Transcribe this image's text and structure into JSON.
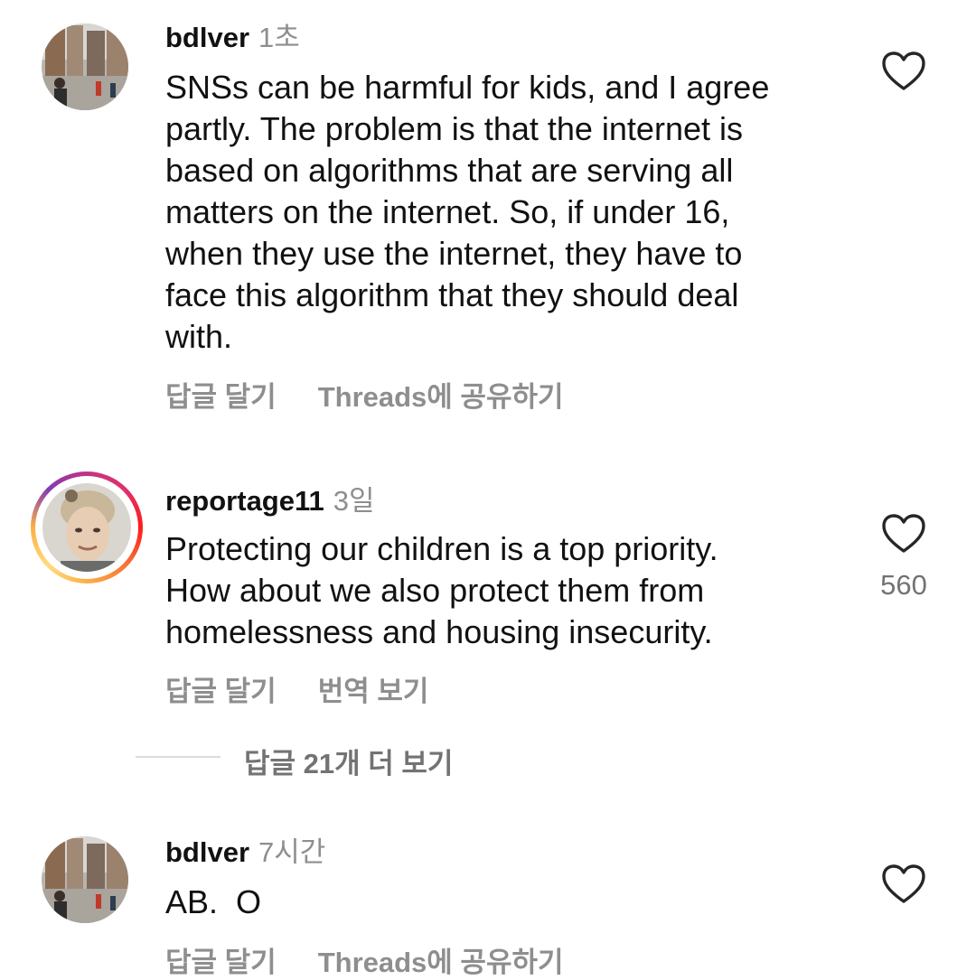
{
  "comments": [
    {
      "username": "bdlver",
      "time": "1초",
      "lines": [
        "SNSs can be harmful for kids, and I agree",
        "partly. The problem is that the internet is",
        "based on algorithms that are serving all",
        "matters on the internet. So, if under 16,",
        "when they use the internet, they have to",
        "face this algorithm that they should deal",
        "with."
      ],
      "actions": [
        "답글 달기",
        "Threads에 공유하기"
      ],
      "avatar_icon": "street-photo-avatar"
    },
    {
      "username": "reportage11",
      "time": "3일",
      "lines": [
        "Protecting our children is a top priority.",
        "How about we also protect them from",
        "homelessness and housing insecurity."
      ],
      "actions": [
        "답글 달기",
        "번역 보기"
      ],
      "like_count": "560",
      "avatar_icon": "portrait-avatar",
      "story_ring": true
    },
    {
      "username": "bdlver",
      "time": "7시간",
      "lines": [
        "AB.  O"
      ],
      "actions": [
        "답글 달기",
        "Threads에 공유하기"
      ],
      "avatar_icon": "street-photo-avatar"
    }
  ],
  "more_replies_label": "답글 21개 더 보기",
  "icons": {
    "like": "heart-outline-icon"
  },
  "colors": {
    "text": "#111111",
    "muted": "#8e8e8e",
    "count": "#737373",
    "divider": "#dbdbdb",
    "ring_gradient": [
      "#c13584",
      "#e1306c",
      "#fd1d1d",
      "#f77737",
      "#fcaf45"
    ]
  }
}
